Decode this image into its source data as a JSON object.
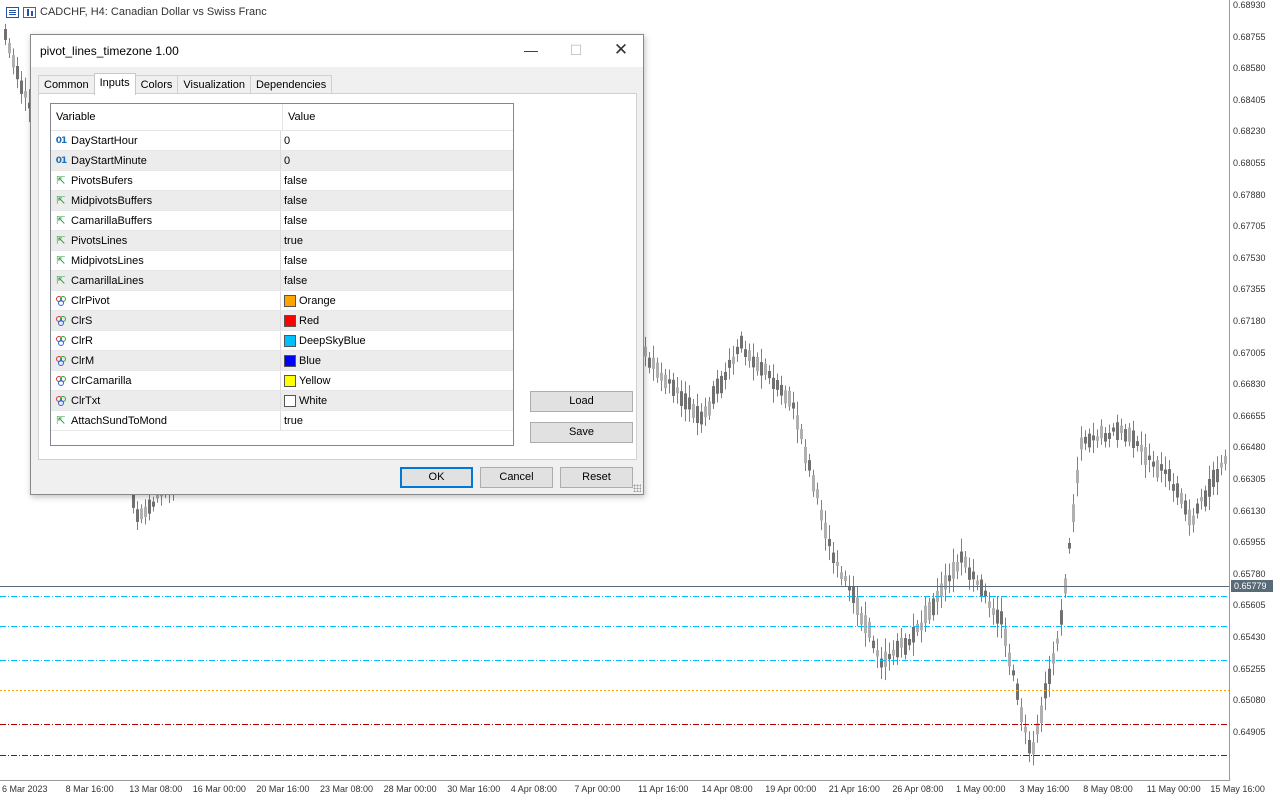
{
  "chart": {
    "title": "CADCHF, H4:  Canadian Dollar vs Swiss Franc",
    "current_price": "0.65779",
    "price_axis": [
      "0.68930",
      "0.68755",
      "0.68580",
      "0.68405",
      "0.68230",
      "0.68055",
      "0.67880",
      "0.67705",
      "0.67530",
      "0.67355",
      "0.67180",
      "0.67005",
      "0.66830",
      "0.66655",
      "0.66480",
      "0.66305",
      "0.66130",
      "0.65955",
      "0.65780",
      "0.65605",
      "0.65430",
      "0.65255",
      "0.65080",
      "0.64905"
    ],
    "time_axis": [
      "6 Mar 2023",
      "8 Mar 16:00",
      "13 Mar 08:00",
      "16 Mar 00:00",
      "20 Mar 16:00",
      "23 Mar 08:00",
      "28 Mar 00:00",
      "30 Mar 16:00",
      "4 Apr 08:00",
      "7 Apr 00:00",
      "11 Apr 16:00",
      "14 Apr 08:00",
      "19 Apr 00:00",
      "21 Apr 16:00",
      "26 Apr 08:00",
      "1 May 00:00",
      "3 May 16:00",
      "8 May 08:00",
      "11 May 00:00",
      "15 May 16:00"
    ],
    "colors": {
      "current_line": "#5a6b78",
      "pivot": "#FFA500",
      "support": "#B00000",
      "resistance": "#00BFFF",
      "candle": "#808080"
    }
  },
  "dialog": {
    "title": "pivot_lines_timezone 1.00",
    "tabs": [
      "Common",
      "Inputs",
      "Colors",
      "Visualization",
      "Dependencies"
    ],
    "active_tab": "Inputs",
    "columns": {
      "variable": "Variable",
      "value": "Value"
    },
    "rows": [
      {
        "icon": "int",
        "name": "DayStartHour",
        "value": "0"
      },
      {
        "icon": "int",
        "name": "DayStartMinute",
        "value": "0"
      },
      {
        "icon": "bool",
        "name": "PivotsBufers",
        "value": "false"
      },
      {
        "icon": "bool",
        "name": "MidpivotsBuffers",
        "value": "false"
      },
      {
        "icon": "bool",
        "name": "CamarillaBuffers",
        "value": "false"
      },
      {
        "icon": "bool",
        "name": "PivotsLines",
        "value": "true"
      },
      {
        "icon": "bool",
        "name": "MidpivotsLines",
        "value": "false"
      },
      {
        "icon": "bool",
        "name": "CamarillaLines",
        "value": "false"
      },
      {
        "icon": "color",
        "name": "ClrPivot",
        "value": "Orange",
        "swatch": "#FFA500"
      },
      {
        "icon": "color",
        "name": "ClrS",
        "value": "Red",
        "swatch": "#FF0000"
      },
      {
        "icon": "color",
        "name": "ClrR",
        "value": "DeepSkyBlue",
        "swatch": "#00BFFF"
      },
      {
        "icon": "color",
        "name": "ClrM",
        "value": "Blue",
        "swatch": "#0000FF"
      },
      {
        "icon": "color",
        "name": "ClrCamarilla",
        "value": "Yellow",
        "swatch": "#FFFF00"
      },
      {
        "icon": "color",
        "name": "ClrTxt",
        "value": "White",
        "swatch": "#FFFFFF"
      },
      {
        "icon": "bool",
        "name": "AttachSundToMond",
        "value": "true"
      }
    ],
    "buttons": {
      "load": "Load",
      "save": "Save",
      "ok": "OK",
      "cancel": "Cancel",
      "reset": "Reset"
    },
    "window_icons": {
      "minimize": "minimize-icon",
      "maximize": "maximize-icon",
      "close": "close-icon"
    }
  }
}
